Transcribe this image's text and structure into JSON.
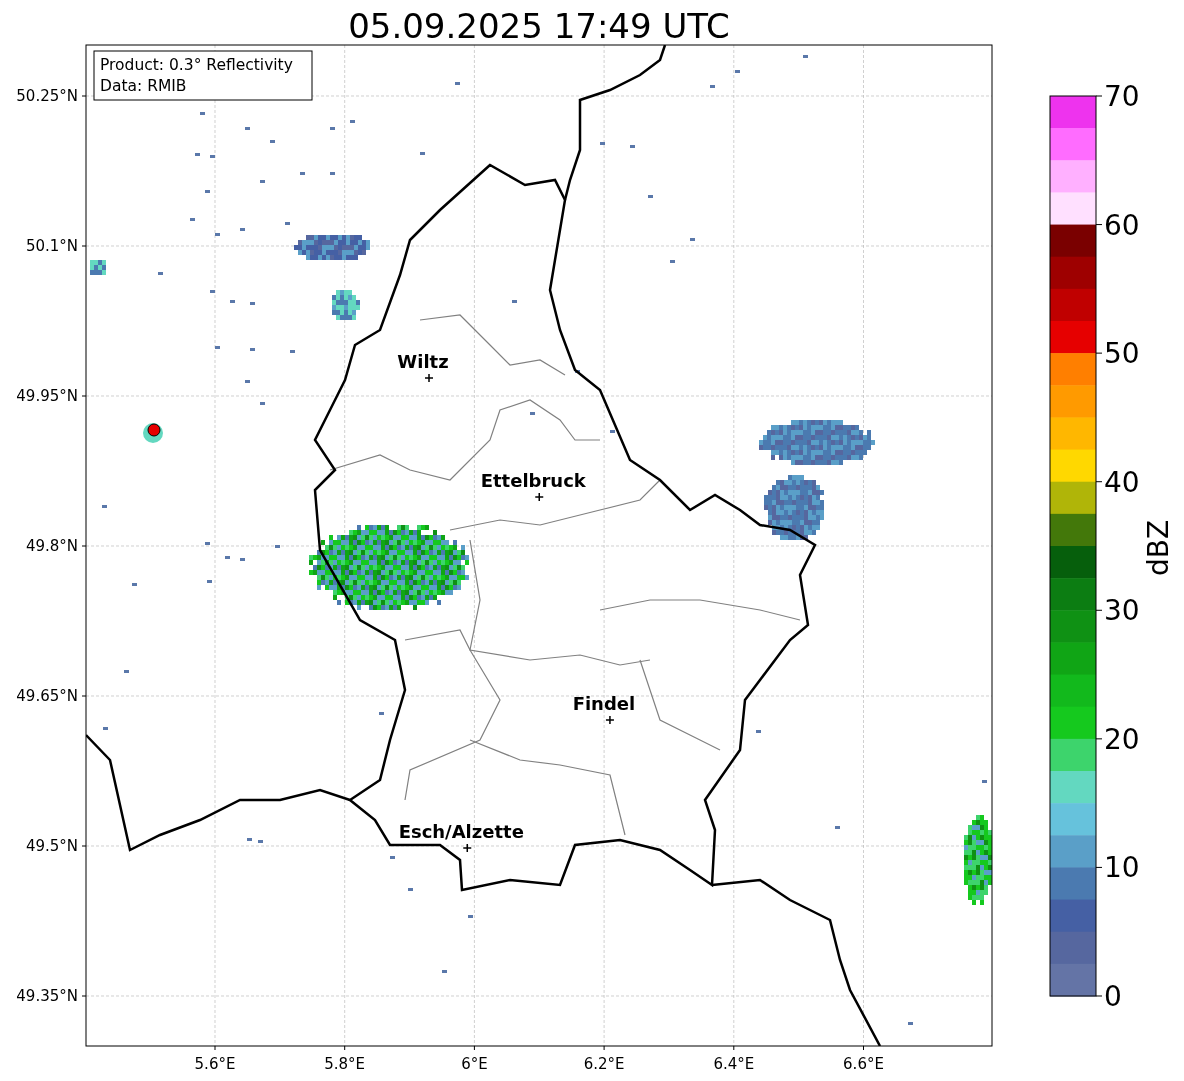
{
  "title": "05.09.2025 17:49 UTC",
  "legend": [
    "Product: 0.3° Reflectivity",
    "Data: RMIB"
  ],
  "lon_ticks": [
    "5.6°E",
    "5.8°E",
    "6°E",
    "6.2°E",
    "6.4°E",
    "6.6°E"
  ],
  "lat_ticks": [
    "50.25°N",
    "50.1°N",
    "49.95°N",
    "49.8°N",
    "49.65°N",
    "49.5°N",
    "49.35°N"
  ],
  "cities": [
    {
      "name": "Wiltz"
    },
    {
      "name": "Ettelbruck"
    },
    {
      "name": "Findel"
    },
    {
      "name": "Esch/Alzette"
    }
  ],
  "colorbar": {
    "label": "dBZ",
    "ticks": [
      "70",
      "60",
      "50",
      "40",
      "30",
      "20",
      "10",
      "0"
    ],
    "segments": [
      {
        "color": "#ee33ee"
      },
      {
        "color": "#ff6cff"
      },
      {
        "color": "#ffb0ff"
      },
      {
        "color": "#ffe0ff"
      },
      {
        "color": "#7a0000"
      },
      {
        "color": "#9e0000"
      },
      {
        "color": "#c00000"
      },
      {
        "color": "#e60000"
      },
      {
        "color": "#ff7f00"
      },
      {
        "color": "#ff9a00"
      },
      {
        "color": "#ffb700"
      },
      {
        "color": "#ffd800"
      },
      {
        "color": "#b0b508"
      },
      {
        "color": "#43780a"
      },
      {
        "color": "#065f0c"
      },
      {
        "color": "#0c7d12"
      },
      {
        "color": "#0f9114"
      },
      {
        "color": "#10a515"
      },
      {
        "color": "#12b91c"
      },
      {
        "color": "#15c91e"
      },
      {
        "color": "#3dd46c"
      },
      {
        "color": "#63d8c0"
      },
      {
        "color": "#66c2dc"
      },
      {
        "color": "#5a9fc8"
      },
      {
        "color": "#4b7ab0"
      },
      {
        "color": "#4560a4"
      },
      {
        "color": "#56679f"
      },
      {
        "color": "#6474a6"
      }
    ]
  }
}
